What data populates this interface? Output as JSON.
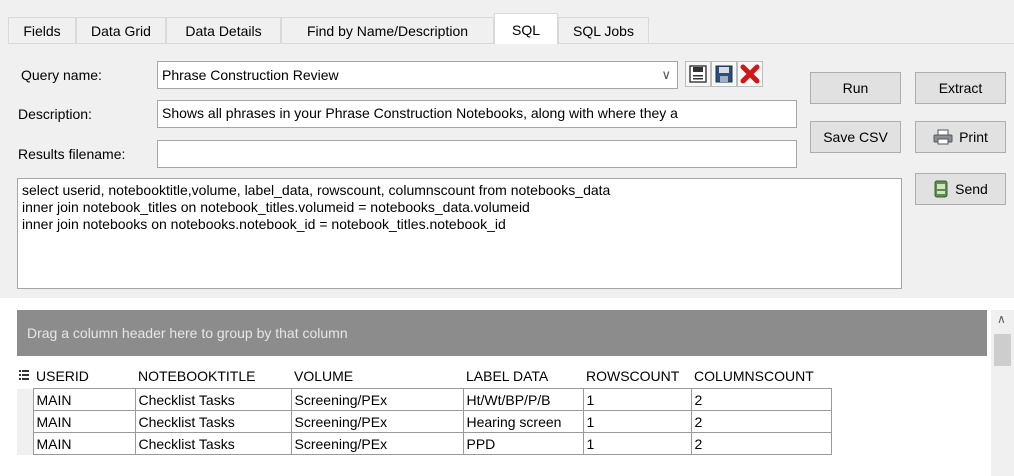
{
  "tabs": [
    {
      "label": "Fields",
      "active": false
    },
    {
      "label": "Data Grid",
      "active": false
    },
    {
      "label": "Data Details",
      "active": false
    },
    {
      "label": "Find by Name/Description",
      "active": false
    },
    {
      "label": "SQL",
      "active": true
    },
    {
      "label": "SQL Jobs",
      "active": false
    }
  ],
  "form": {
    "query_name_label": "Query name:",
    "query_name_value": "Phrase Construction Review",
    "description_label": "Description:",
    "description_value": "Shows all phrases in your Phrase Construction Notebooks, along with where they a",
    "results_filename_label": "Results filename:",
    "results_filename_value": "",
    "icons": [
      "save-icon",
      "save-as-icon",
      "delete-icon"
    ]
  },
  "buttons": {
    "run": "Run",
    "extract": "Extract",
    "save_csv": "Save CSV",
    "print": "Print",
    "send": "Send"
  },
  "sql_text": "select userid, notebooktitle,volume, label_data, rowscount, columnscount from notebooks_data\ninner join notebook_titles on notebook_titles.volumeid = notebooks_data.volumeid\ninner join notebooks on notebooks.notebook_id = notebook_titles.notebook_id",
  "grid": {
    "group_hint": "Drag a column header here to group by that column",
    "columns": [
      "USERID",
      "NOTEBOOKTITLE",
      "VOLUME",
      "LABEL DATA",
      "ROWSCOUNT",
      "COLUMNSCOUNT"
    ],
    "rows": [
      [
        "MAIN",
        "Checklist Tasks",
        "Screening/PEx",
        "Ht/Wt/BP/P/B",
        "1",
        "2"
      ],
      [
        "MAIN",
        "Checklist Tasks",
        "Screening/PEx",
        "Hearing screen",
        "1",
        "2"
      ],
      [
        "MAIN",
        "Checklist Tasks",
        "Screening/PEx",
        "PPD",
        "1",
        "2"
      ]
    ]
  },
  "colors": {
    "group_band": "#8c8c8c",
    "delete_red": "#d0181b",
    "button_face": "#e1e1e1"
  }
}
